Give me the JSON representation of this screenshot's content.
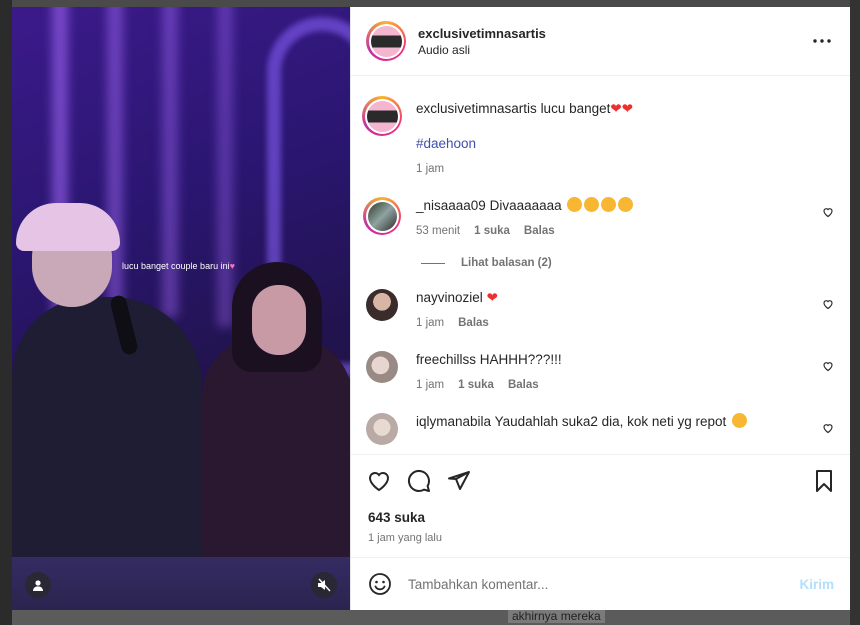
{
  "post": {
    "username": "exclusivetimnasartis",
    "audio": "Audio asli",
    "more_icon": "more-horizontal-icon",
    "video_overlay_text": "lucu banget couple baru ini",
    "caption": {
      "username": "exclusivetimnasartis",
      "text": "lucu banget",
      "hashtag": "#daehoon",
      "time": "1 jam"
    },
    "likes": "643 suka",
    "posted": "1 jam yang lalu",
    "add_comment_placeholder": "Tambahkan komentar...",
    "send_label": "Kirim"
  },
  "comments": [
    {
      "username": "_nisaaaa09",
      "text": "Divaaaaaaa",
      "time": "53 menit",
      "likes": "1 suka",
      "reply": "Balas",
      "emoji_count": 4
    },
    {
      "username": "nayvinoziel",
      "text": "",
      "time": "1 jam",
      "likes": "",
      "reply": "Balas"
    },
    {
      "username": "freechillss",
      "text": "HAHHH???!!!",
      "time": "1 jam",
      "likes": "1 suka",
      "reply": "Balas"
    },
    {
      "username": "iqlymanabila",
      "text": "Yaudahlah suka2 dia, kok neti yg repot",
      "time": "",
      "likes": "",
      "reply": ""
    }
  ],
  "view_replies": "Lihat balasan (2)",
  "background": {
    "caption_fragment": "akhirnya mereka"
  },
  "colors": {
    "accent_link": "#3f50a8",
    "muted": "#737373",
    "send_disabled": "#b2dffc",
    "heart": "#ed2f2f"
  }
}
